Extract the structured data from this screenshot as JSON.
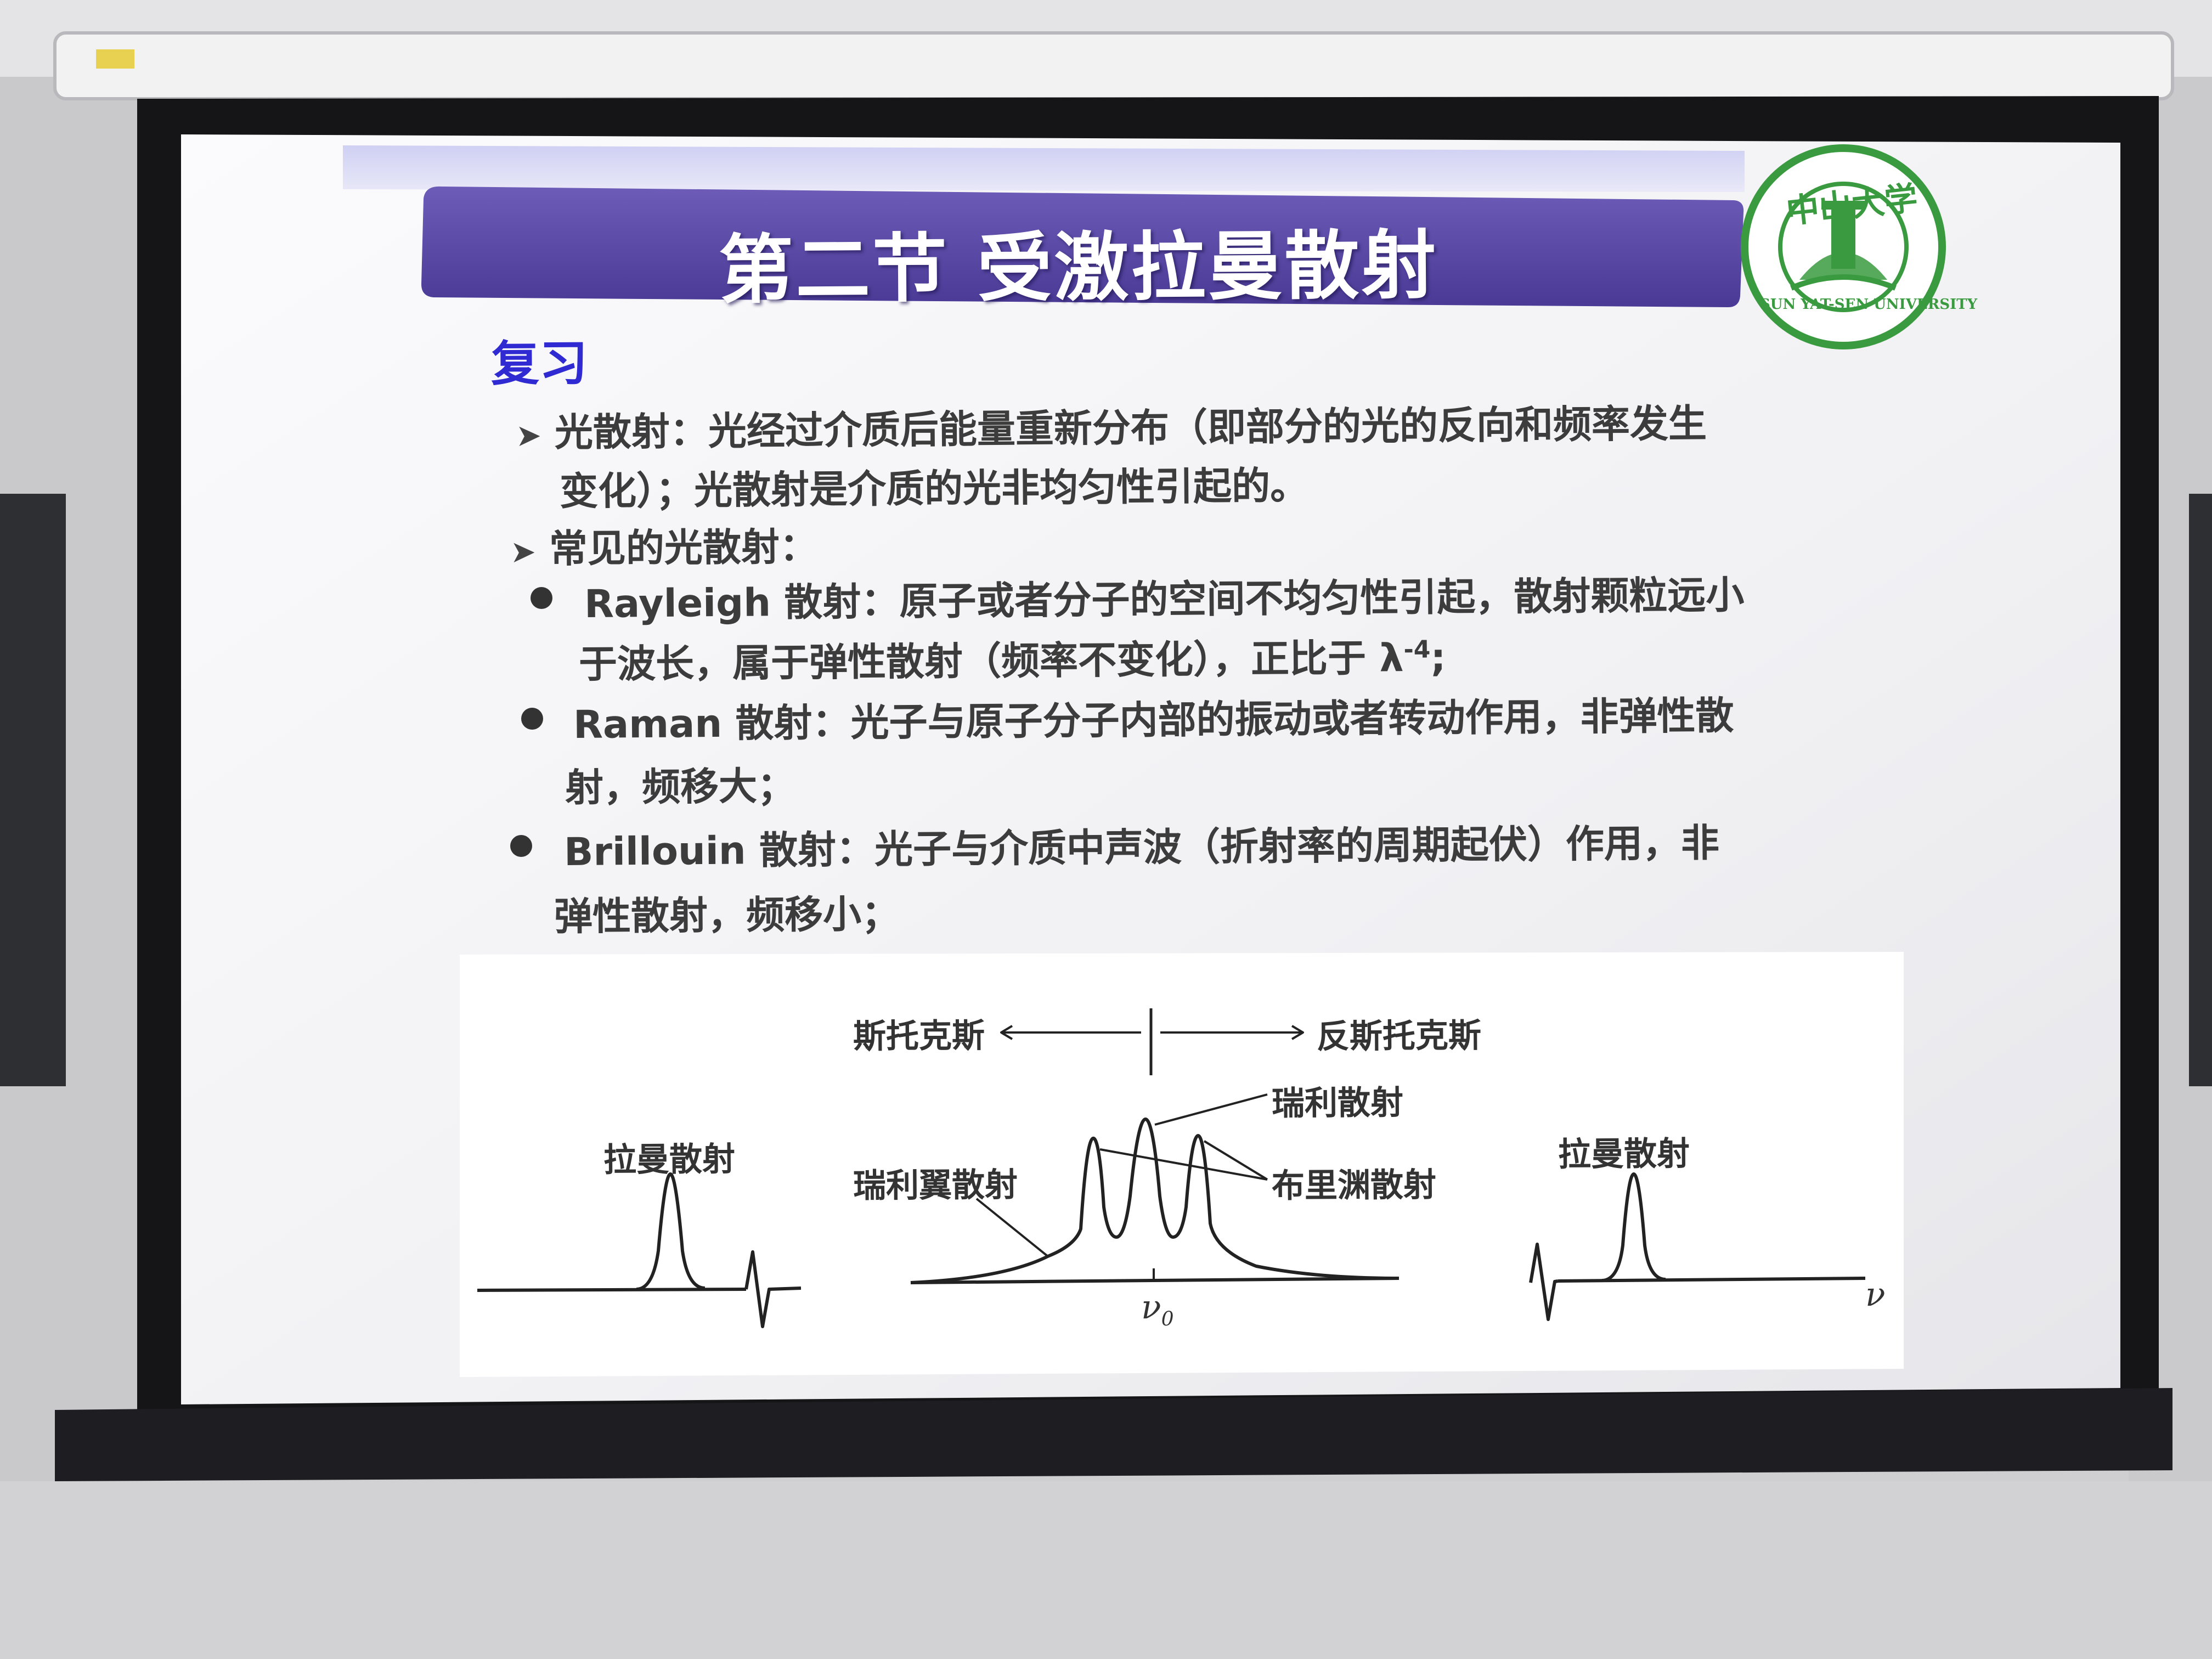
{
  "slide": {
    "title": "第二节 受激拉曼散射",
    "section_heading": "复习",
    "bullet_1": {
      "line1": "光散射：光经过介质后能量重新分布（即部分的光的反向和频率发生",
      "line2": "变化）；光散射是介质的光非均匀性引起的。"
    },
    "bullet_2": "常见的光散射：",
    "items": [
      {
        "line1": "Rayleigh 散射：原子或者分子的空间不均匀性引起，散射颗粒远小",
        "line2": "于波长，属于弹性散射（频率不变化），正比于 λ",
        "line2_sup": "-4",
        "line2_tail": ";"
      },
      {
        "line1": "Raman 散射：光子与原子分子内部的振动或者转动作用，非弹性散",
        "line2": "射，频移大；"
      },
      {
        "line1": "Brillouin 散射：光子与介质中声波（折射率的周期起伏）作用，非",
        "line2": "弹性散射，频移小；"
      }
    ]
  },
  "logo": {
    "top_text": "中山大学",
    "ring_text": "SUN YAT-SEN UNIVERSITY",
    "color": "#3a9a3f"
  },
  "figure": {
    "stokes": "斯托克斯",
    "anti_stokes": "反斯托克斯",
    "rayleigh": "瑞利散射",
    "rayleigh_wing": "瑞利翼散射",
    "brillouin": "布里渊散射",
    "raman_left": "拉曼散射",
    "raman_right": "拉曼散射",
    "nu0": "ν",
    "nu0_sub": "0",
    "nu": "ν"
  },
  "colors": {
    "title_bar": "#5a48a6",
    "heading_blue": "#2f2ad1",
    "slide_bg": "#f3f3f6"
  }
}
